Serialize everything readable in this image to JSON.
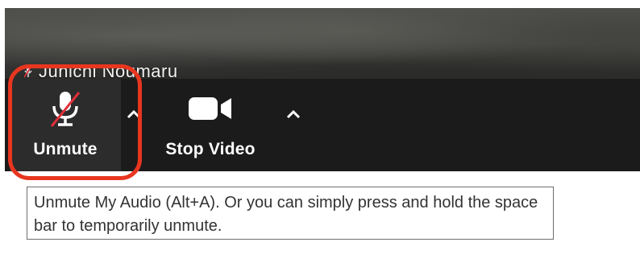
{
  "participant": {
    "name": "Junichi Noumaru",
    "muted_icon": "muted-mic-icon"
  },
  "toolbar": {
    "unmute_label": "Unmute",
    "unmute_icon": "microphone-muted-icon",
    "stop_video_label": "Stop Video",
    "stop_video_icon": "video-camera-icon",
    "audio_options_icon": "chevron-up-icon",
    "video_options_icon": "chevron-up-icon"
  },
  "tooltip": {
    "text": "Unmute My Audio (Alt+A). Or you can simply press and hold the space bar to temporarily unmute."
  },
  "colors": {
    "toolbar_bg": "#1b1b1b",
    "active_button_bg": "#2c2c2c",
    "mute_slash": "#e0303a",
    "highlight_ring": "#e8361f"
  }
}
